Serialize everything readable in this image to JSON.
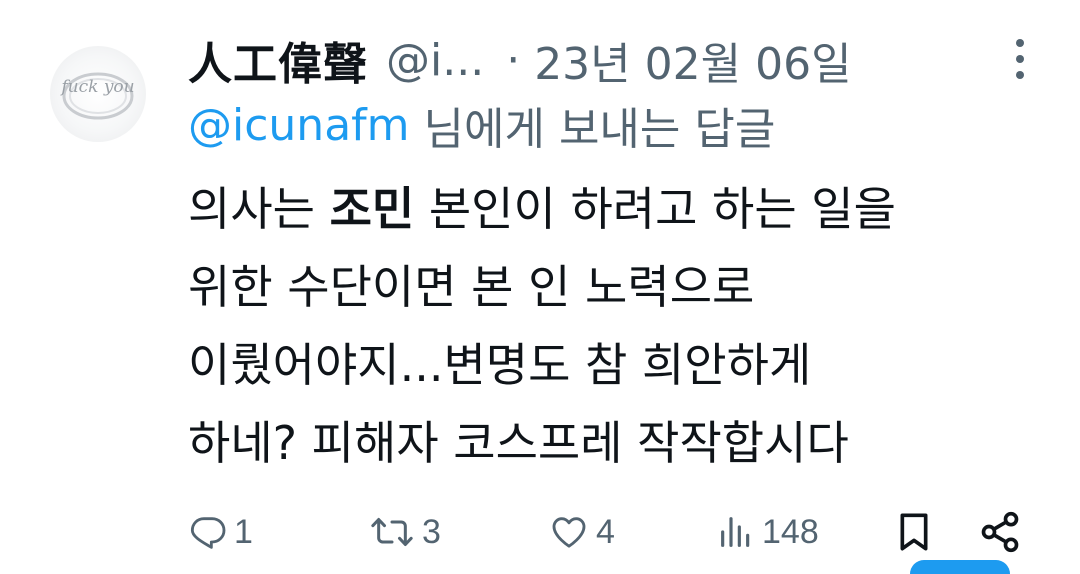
{
  "tweet": {
    "author_name": "人工偉聲",
    "author_handle": "@i...",
    "separator": "·",
    "date": "23년 02월 06일",
    "reply_mention": "@icunafm",
    "reply_suffix": "님에게 보내는 답글",
    "body_lines": [
      [
        "의사는 ",
        "조민",
        " 본인이 하려고 하는 일을"
      ],
      [
        "위한 수단이면 본 인 노력으로"
      ],
      [
        "이뤘어야지...변명도 참 희안하게"
      ],
      [
        "하네? 피해자 코스프레 작작합시다"
      ]
    ],
    "avatar_text": "fuck you",
    "accent_color": "#1d9bf0",
    "muted_color": "#536471"
  },
  "actions": {
    "replies": "1",
    "retweets": "3",
    "likes": "4",
    "views": "148",
    "icons": [
      "reply-icon",
      "retweet-icon",
      "like-icon",
      "views-icon",
      "bookmark-icon",
      "share-icon"
    ]
  }
}
